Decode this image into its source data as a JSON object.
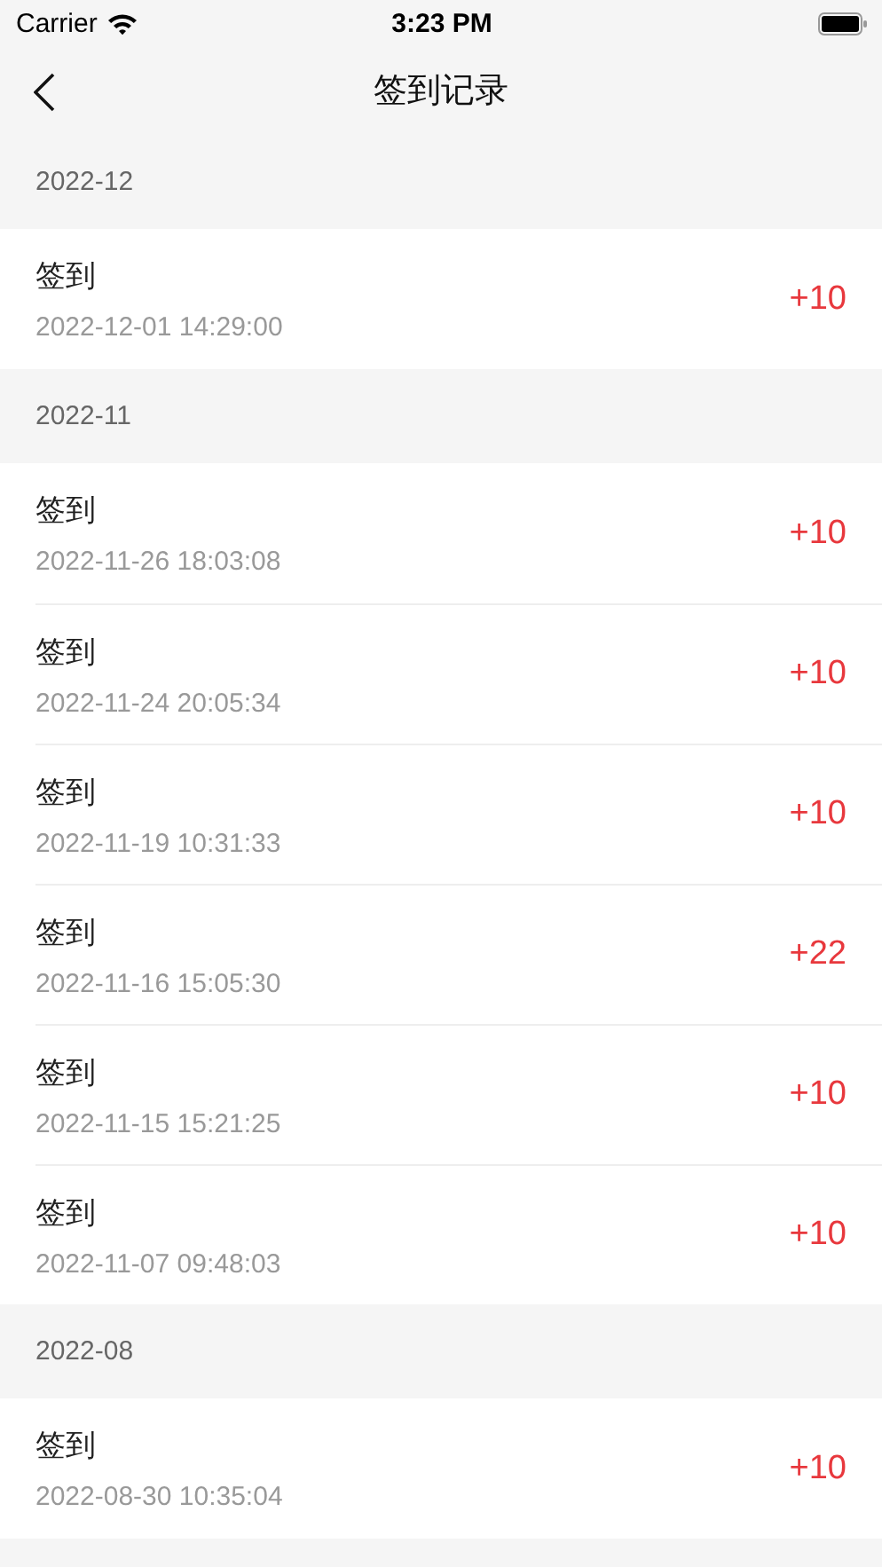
{
  "status_bar": {
    "carrier": "Carrier",
    "time": "3:23 PM"
  },
  "nav": {
    "title": "签到记录"
  },
  "sections": [
    {
      "month": "2022-12",
      "records": [
        {
          "title": "签到",
          "time": "2022-12-01 14:29:00",
          "points": "+10"
        }
      ]
    },
    {
      "month": "2022-11",
      "records": [
        {
          "title": "签到",
          "time": "2022-11-26 18:03:08",
          "points": "+10"
        },
        {
          "title": "签到",
          "time": "2022-11-24 20:05:34",
          "points": "+10"
        },
        {
          "title": "签到",
          "time": "2022-11-19 10:31:33",
          "points": "+10"
        },
        {
          "title": "签到",
          "time": "2022-11-16 15:05:30",
          "points": "+22"
        },
        {
          "title": "签到",
          "time": "2022-11-15 15:21:25",
          "points": "+10"
        },
        {
          "title": "签到",
          "time": "2022-11-07 09:48:03",
          "points": "+10"
        }
      ]
    },
    {
      "month": "2022-08",
      "records": [
        {
          "title": "签到",
          "time": "2022-08-30 10:35:04",
          "points": "+10"
        }
      ]
    }
  ]
}
